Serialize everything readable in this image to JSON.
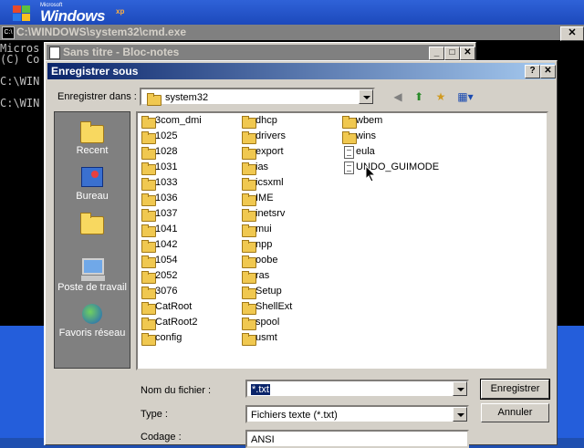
{
  "desktop": {
    "logo_ms": "Microsoft",
    "logo_word": "Windows",
    "logo_xp": "xp"
  },
  "cmd": {
    "title": "C:\\WINDOWS\\system32\\cmd.exe",
    "icon_text": "C:\\",
    "lines": [
      "Micros",
      "(C) Co",
      "",
      "C:\\WIN",
      "",
      "C:\\WIN"
    ]
  },
  "notepad": {
    "title": "Sans titre - Bloc-notes"
  },
  "dialog": {
    "title": "Enregistrer sous",
    "save_in_label": "Enregistrer dans :",
    "save_in_value": "system32",
    "places": [
      {
        "label": "Recent",
        "icon": "recent-folder-icon"
      },
      {
        "label": "Bureau",
        "icon": "desktop-icon"
      },
      {
        "label": "",
        "icon": "my-documents-folder-icon"
      },
      {
        "label": "Poste de travail",
        "icon": "my-computer-icon"
      },
      {
        "label": "Favoris réseau",
        "icon": "network-places-icon"
      }
    ],
    "files_col1": [
      "3com_dmi",
      "1025",
      "1028",
      "1031",
      "1033",
      "1036",
      "1037",
      "1041",
      "1042",
      "1054",
      "2052",
      "3076",
      "CatRoot",
      "CatRoot2",
      "config"
    ],
    "files_col2": [
      "dhcp",
      "drivers",
      "export",
      "ias",
      "icsxml",
      "IME",
      "inetsrv",
      "mui",
      "npp",
      "oobe",
      "ras",
      "Setup",
      "ShellExt",
      "spool",
      "usmt"
    ],
    "files_col3": [
      {
        "name": "wbem",
        "type": "folder"
      },
      {
        "name": "wins",
        "type": "folder"
      },
      {
        "name": "eula",
        "type": "file"
      },
      {
        "name": "UNDO_GUIMODE",
        "type": "file"
      }
    ],
    "filename_label": "Nom du fichier :",
    "filename_value": "*.txt",
    "type_label": "Type :",
    "type_value": "Fichiers texte (*.txt)",
    "encoding_label": "Codage :",
    "encoding_value": "ANSI",
    "save_button": "Enregistrer",
    "cancel_button": "Annuler"
  }
}
